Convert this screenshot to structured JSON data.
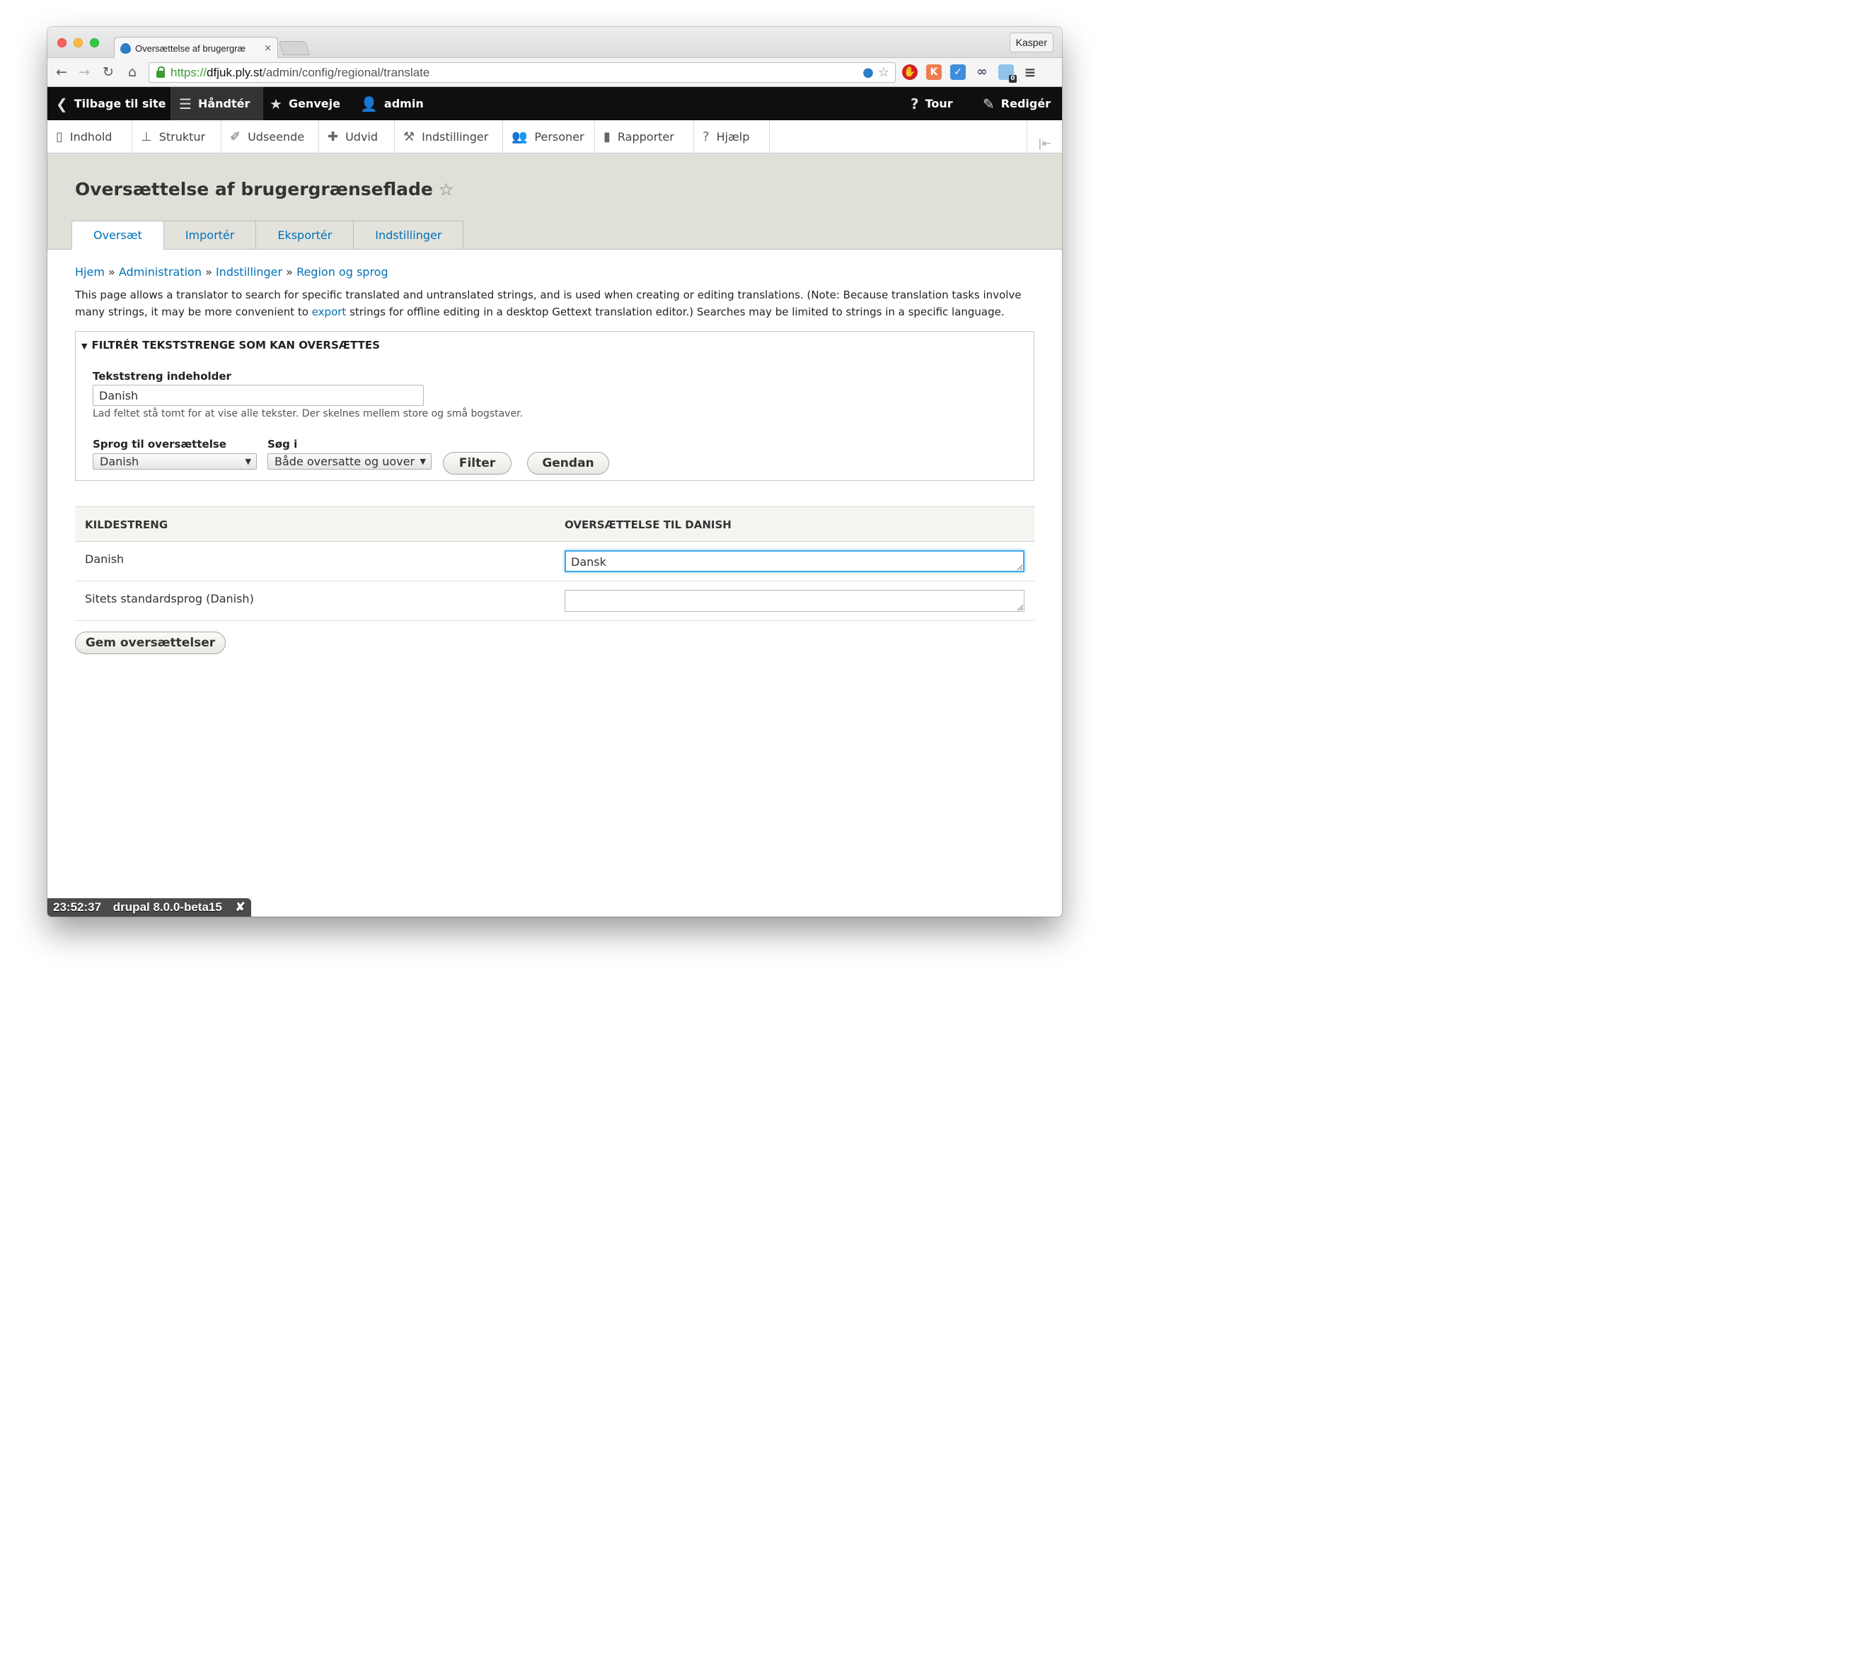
{
  "browser": {
    "tab_title": "Oversættelse af brugergræ",
    "tab_close": "×",
    "profile": "Kasper",
    "url_scheme": "https://",
    "url_host": "dfjuk.ply.st",
    "url_path": "/admin/config/regional/translate",
    "ext_badge": "0"
  },
  "toolbar": {
    "back": "Tilbage til site",
    "manage": "Håndtér",
    "shortcuts": "Genveje",
    "user": "admin",
    "tour": "Tour",
    "edit": "Redigér"
  },
  "tray": {
    "items": [
      "Indhold",
      "Struktur",
      "Udseende",
      "Udvid",
      "Indstillinger",
      "Personer",
      "Rapporter",
      "Hjælp"
    ]
  },
  "page": {
    "title": "Oversættelse af brugergrænseflade",
    "tabs": [
      "Oversæt",
      "Importér",
      "Eksportér",
      "Indstillinger"
    ]
  },
  "breadcrumb": [
    "Hjem",
    "Administration",
    "Indstillinger",
    "Region og sprog"
  ],
  "breadcrumb_sep": "»",
  "help": {
    "part1": "This page allows a translator to search for specific translated and untranslated strings, and is used when creating or editing translations. (Note: Because translation tasks involve many strings, it may be more convenient to ",
    "link": "export",
    "part2": " strings for offline editing in a desktop Gettext translation editor.) Searches may be limited to strings in a specific language."
  },
  "filter": {
    "legend": "Filtrér tekststrenge som kan oversættes",
    "string_label": "Tekststreng indeholder",
    "string_value": "Danish",
    "string_desc": "Lad feltet stå tomt for at vise alle tekster. Der skelnes mellem store og små bogstaver.",
    "lang_label": "Sprog til oversættelse",
    "lang_value": "Danish",
    "search_label": "Søg i",
    "search_value": "Både oversatte og uover",
    "filter_btn": "Filter",
    "reset_btn": "Gendan"
  },
  "table": {
    "col_source": "Kildestreng",
    "col_translation": "Oversættelse til Danish",
    "rows": [
      {
        "source": "Danish",
        "translation": "Dansk"
      },
      {
        "source": "Sitets standardsprog (Danish)",
        "translation": ""
      }
    ]
  },
  "save_btn": "Gem oversættelser",
  "status": {
    "time": "23:52:37",
    "label": "drupal 8.0.0-beta15",
    "close": "✘"
  }
}
